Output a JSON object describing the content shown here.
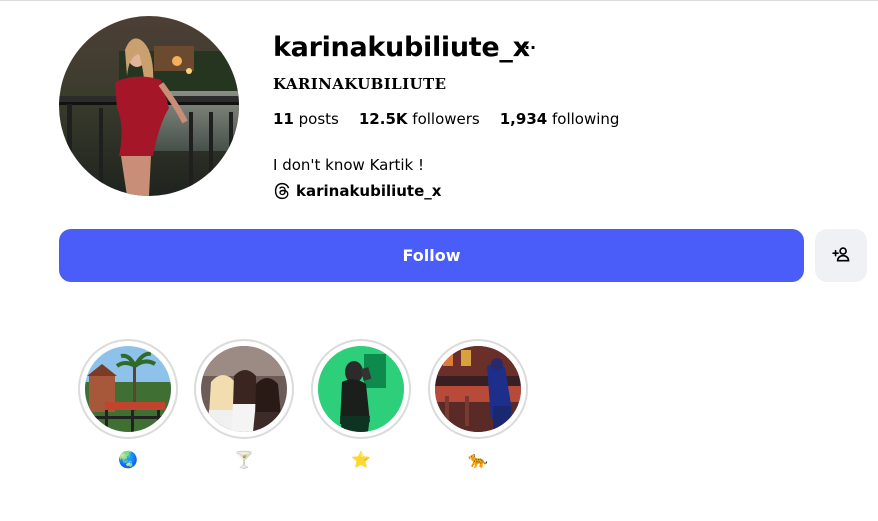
{
  "profile": {
    "username": "karinakubiliute_x",
    "more_label": "···",
    "full_name": "KARINAKUBILIUTE",
    "stats": {
      "posts_count": "11",
      "posts_label": "posts",
      "followers_count": "12.5K",
      "followers_label": "followers",
      "following_count": "1,934",
      "following_label": "following"
    },
    "bio": "I don't know Kartik !",
    "threads_handle": "karinakubiliute_x"
  },
  "actions": {
    "follow_label": "Follow"
  },
  "highlights": [
    {
      "label": "🌏",
      "icon": "globe-emoji"
    },
    {
      "label": "🍸",
      "icon": "cocktail-emoji"
    },
    {
      "label": "⭐",
      "icon": "star-emoji"
    },
    {
      "label": "🐆",
      "icon": "leopard-emoji"
    }
  ],
  "colors": {
    "follow_button": "#4a5df9",
    "secondary_button": "#eff1f4",
    "highlight_ring": "#dbdbdb"
  }
}
